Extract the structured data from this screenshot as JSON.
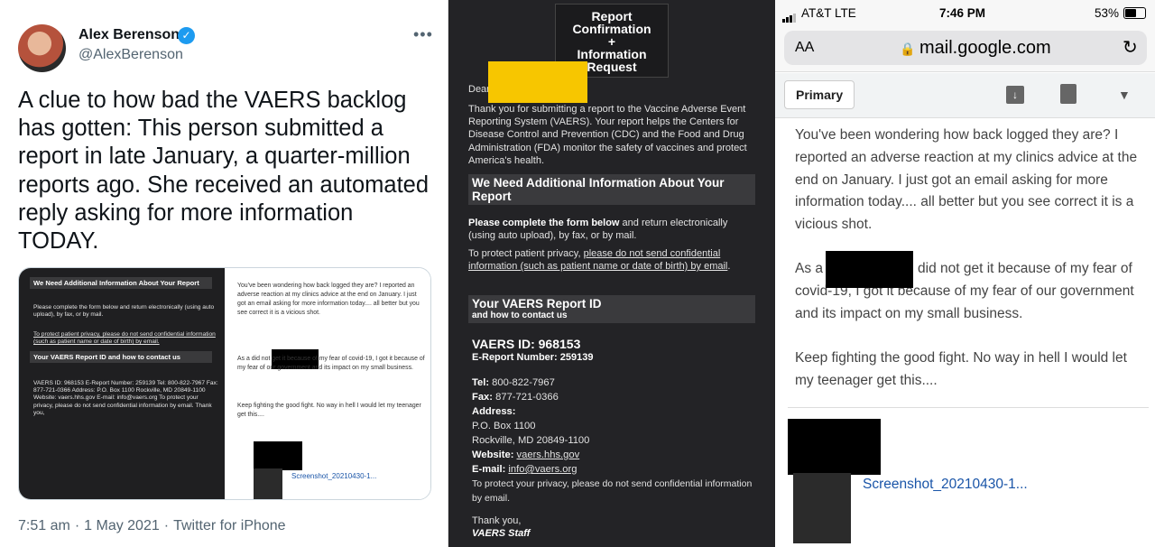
{
  "tweet": {
    "name": "Alex Berenson",
    "handle": "@AlexBerenson",
    "more": "•••",
    "text": "A clue to how bad the VAERS backlog has gotten: This person submitted a report in late January, a quarter-million reports ago. She received an automated reply asking for more information TODAY.",
    "time": "7:51 am",
    "date": "1 May 2021",
    "source": "Twitter for iPhone",
    "sep": "·"
  },
  "embed": {
    "left_header": "We Need Additional Information About Your Report",
    "left_b1": "Please complete the form below and return electronically (using auto upload), by fax, or by mail.",
    "left_b2": "To protect patient privacy, please do not send confidential information (such as patient name or date of birth) by email.",
    "left_header2": "Your VAERS Report ID and how to contact us",
    "left_b3": "VAERS ID: 968153 E-Report Number: 259139  Tel: 800-822-7967 Fax: 877-721-0366 Address: P.O. Box 1100 Rockville, MD 20849-1100 Website: vaers.hhs.gov E-mail: info@vaers.org To protect your privacy, please do not send confidential information by email.  Thank you,",
    "right_p1": "You've been wondering how back logged they are? I reported an adverse reaction at my clinics advice at the end on January. I just got an email asking for more information today.... all better but you see correct it is a vicious shot.",
    "right_p2": "As a did not get it because of my fear of covid-19, I got it because of my fear of our government and its impact on my small business.",
    "right_p3": "Keep fighting the good fight. No way in hell I would let my teenager get this....",
    "right_att": "Screenshot_20210430-1..."
  },
  "vaers": {
    "top_line1": "Report",
    "top_line2": "Confirmation",
    "top_line3": "+",
    "top_line4": "Information",
    "top_line5": "Request",
    "dear": "Dear",
    "intro": "Thank you for submitting a report to the Vaccine Adverse Event Reporting System (VAERS). Your report helps the Centers for Disease Control and Prevention (CDC) and the Food and Drug Administration (FDA) monitor the safety of vaccines and protect America's health.",
    "h1": "We Need Additional Information About Your Report",
    "p1_bold": "Please complete the form below",
    "p1_rest": " and return electronically (using auto upload), by fax, or by mail.",
    "p2_plain": "To protect patient privacy, ",
    "p2_link": "please do not send confidential information (such as patient name or date of birth) by email",
    "p2_end": ".",
    "h2": "Your VAERS Report ID",
    "h2_sub": "and how to contact us",
    "vaers_id": "VAERS ID: 968153",
    "ereport": "E-Report Number: 259139",
    "tel_label": "Tel:",
    "tel": " 800-822-7967",
    "fax_label": "Fax:",
    "fax": " 877-721-0366",
    "addr_label": "Address:",
    "addr1": "P.O. Box 1100",
    "addr2": "Rockville, MD 20849-1100",
    "web_label": "Website:",
    "web": "vaers.hhs.gov",
    "email_label": "E-mail:",
    "email": "info@vaers.org",
    "privacy": "To protect your privacy, please do not send confidential information by email.",
    "thanks": "Thank you,",
    "staff": "VAERS Staff"
  },
  "gmail": {
    "carrier": "AT&T  LTE",
    "time": "7:46 PM",
    "battery": "53%",
    "aa": "AA",
    "domain": "mail.google.com",
    "reload": "↻",
    "primary": "Primary",
    "caret": "▼",
    "p1": "You've been wondering how back logged they are?  I reported an adverse reaction at my clinics advice at the end on January.  I just got an email asking for more information today.... all better but you see correct it is a vicious shot.",
    "p2_a": "As a",
    "p2_b": "did not get it because of my fear of covid-19, I got it because of my fear of our government and its impact on my small business.",
    "p3": "Keep fighting the good fight.  No way in hell I would let my teenager get this....",
    "attachment": "Screenshot_20210430-1..."
  }
}
